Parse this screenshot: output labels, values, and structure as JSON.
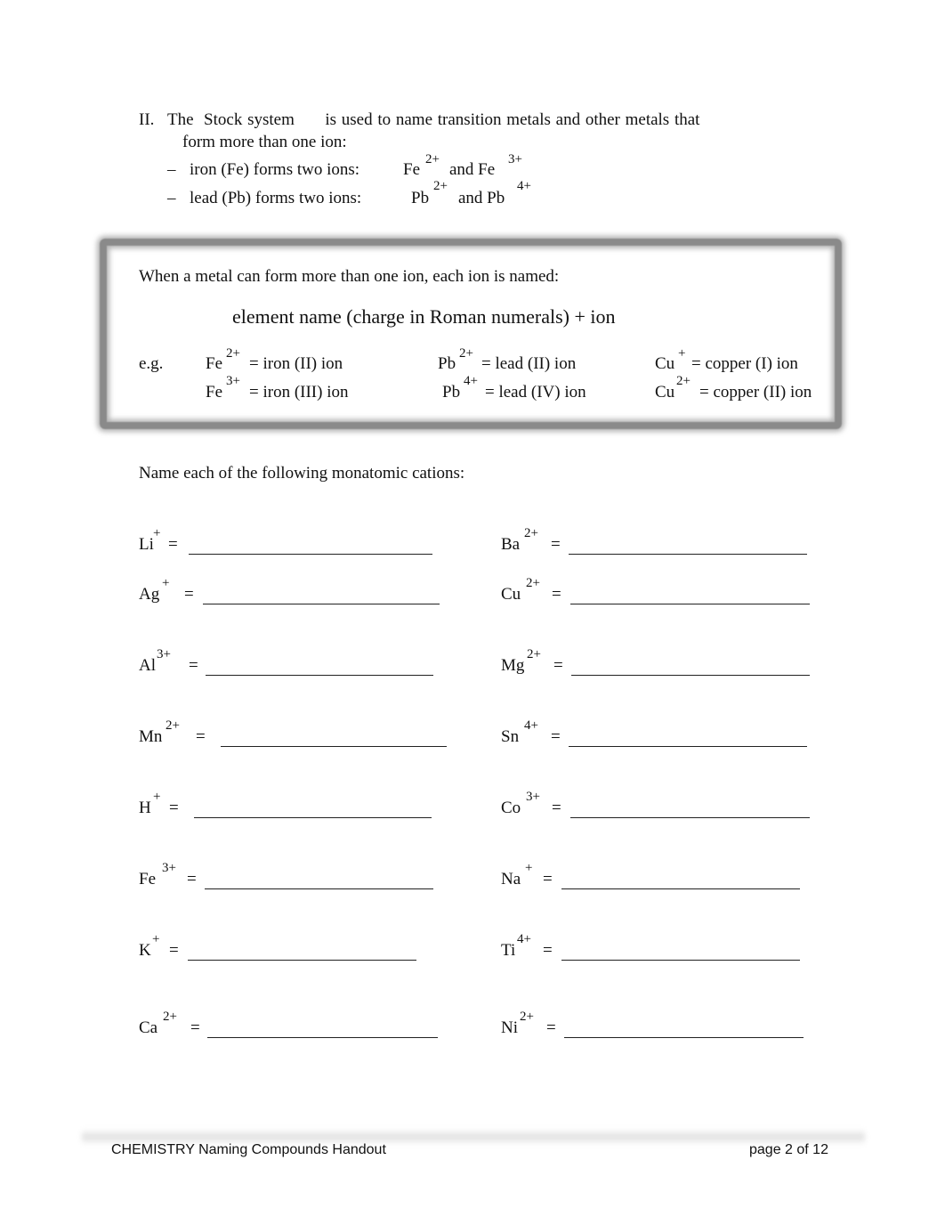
{
  "section": {
    "number": "II.",
    "intro_line1": "The  Stock system      is used to name transition metals and other metals that",
    "intro_line2": "form more than one ion:",
    "bullets": [
      {
        "dash": "–",
        "text": "iron (Fe) forms two ions:",
        "ion1_symbol": "Fe",
        "ion1_charge": "2+",
        "joiner": "and Fe",
        "ion2_charge": "3+"
      },
      {
        "dash": "–",
        "text": "lead (Pb) forms two ions:",
        "ion1_symbol": "Pb",
        "ion1_charge": "2+",
        "joiner": "and Pb",
        "ion2_charge": "4+"
      }
    ]
  },
  "rule_box": {
    "intro": "When a metal can form more than one ion, each ion is named:",
    "formula": "element name (charge in Roman numerals) + ion",
    "eg_label": "e.g.",
    "examples": [
      {
        "symbol": "Fe",
        "charge": "2+",
        "name": "= iron (II) ion"
      },
      {
        "symbol": "Fe",
        "charge": "3+",
        "name": "= iron (III) ion"
      },
      {
        "symbol": "Pb",
        "charge": "2+",
        "name": "= lead (II) ion"
      },
      {
        "symbol": "Pb",
        "charge": "4+",
        "name": "= lead (IV) ion"
      },
      {
        "symbol": "Cu",
        "charge": "+",
        "name": "= copper (I) ion"
      },
      {
        "symbol": "Cu",
        "charge": "2+",
        "name": "= copper (II) ion"
      }
    ]
  },
  "exercise": {
    "instruction": "Name each of the following monatomic cations:",
    "equals": "=",
    "left_column": [
      {
        "symbol": "Li",
        "charge": "+",
        "answer": ""
      },
      {
        "symbol": "Ag",
        "charge": "+",
        "answer": ""
      },
      {
        "symbol": "Al",
        "charge": "3+",
        "answer": ""
      },
      {
        "symbol": "Mn",
        "charge": "2+",
        "answer": ""
      },
      {
        "symbol": "H",
        "charge": "+",
        "answer": ""
      },
      {
        "symbol": "Fe",
        "charge": "3+",
        "answer": ""
      },
      {
        "symbol": "K",
        "charge": "+",
        "answer": ""
      },
      {
        "symbol": "Ca",
        "charge": "2+",
        "answer": ""
      }
    ],
    "right_column": [
      {
        "symbol": "Ba",
        "charge": "2+",
        "answer": ""
      },
      {
        "symbol": "Cu",
        "charge": "2+",
        "answer": ""
      },
      {
        "symbol": "Mg",
        "charge": "2+",
        "answer": ""
      },
      {
        "symbol": "Sn",
        "charge": "4+",
        "answer": ""
      },
      {
        "symbol": "Co",
        "charge": "3+",
        "answer": ""
      },
      {
        "symbol": "Na",
        "charge": "+",
        "answer": ""
      },
      {
        "symbol": "Ti",
        "charge": "4+",
        "answer": ""
      },
      {
        "symbol": "Ni",
        "charge": "2+",
        "answer": ""
      }
    ]
  },
  "footer": {
    "title": "CHEMISTRY Naming Compounds Handout",
    "page": "page 2 of 12"
  }
}
